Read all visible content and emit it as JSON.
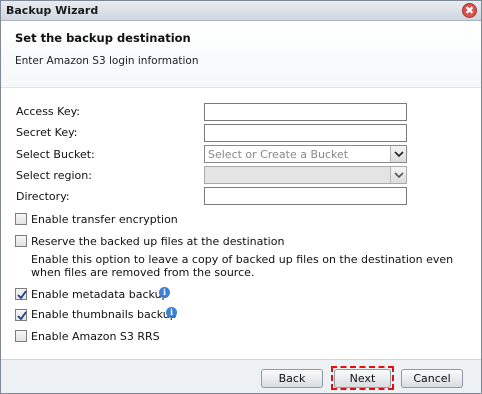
{
  "window": {
    "title": "Backup Wizard",
    "close_symbol": "✖"
  },
  "header": {
    "title": "Set the backup destination",
    "subtitle": "Enter Amazon S3 login information"
  },
  "form": {
    "access_key_label": "Access Key:",
    "access_key_value": "",
    "secret_key_label": "Secret Key:",
    "secret_key_value": "",
    "bucket_label": "Select Bucket:",
    "bucket_placeholder": "Select or Create a Bucket",
    "region_label": "Select region:",
    "region_value": "",
    "directory_label": "Directory:",
    "directory_value": ""
  },
  "options": {
    "transfer_encryption": {
      "label": "Enable transfer encryption",
      "checked": false
    },
    "reserve_files": {
      "label": "Reserve the backed up files at the destination",
      "checked": false
    },
    "reserve_desc": "Enable this option to leave a copy of backed up files on the destination even when files are removed from the source.",
    "metadata_backup": {
      "label": "Enable metadata backup",
      "checked": true
    },
    "thumbnails_backup": {
      "label": "Enable thumbnails backup",
      "checked": true
    },
    "s3_rrs": {
      "label": "Enable Amazon S3 RRS",
      "checked": false
    },
    "info_symbol": "i"
  },
  "footer": {
    "back_label": "Back",
    "next_label": "Next",
    "cancel_label": "Cancel"
  },
  "colors": {
    "highlight": "#e01010",
    "info_icon": "#3b7fd6",
    "close_icon": "#d9534f"
  }
}
